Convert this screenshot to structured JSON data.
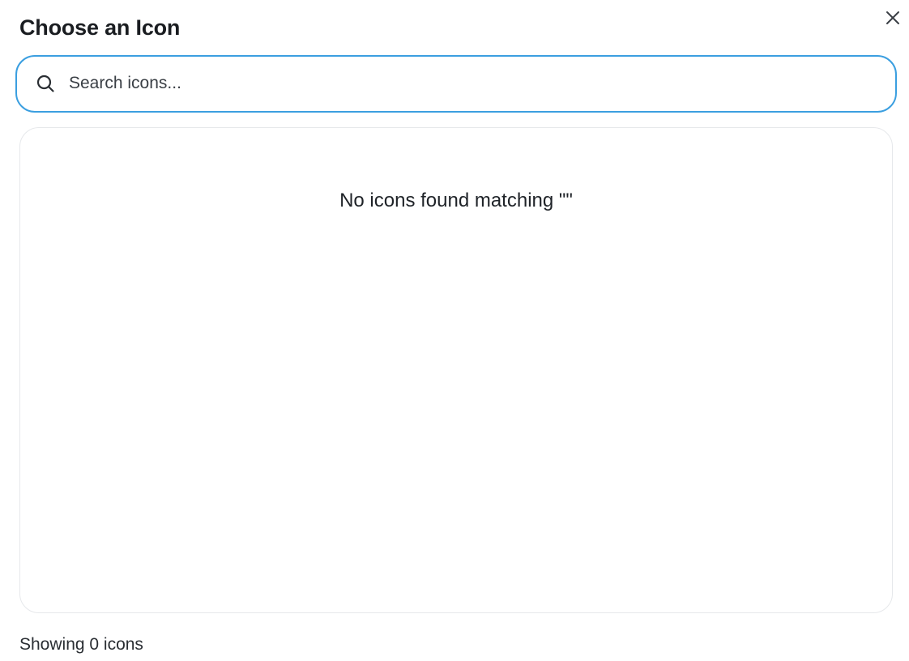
{
  "dialog": {
    "title": "Choose an Icon",
    "close_icon": "close-icon"
  },
  "search": {
    "icon": "search-icon",
    "placeholder": "Search icons...",
    "value": "",
    "focus_color": "#3b9fe0"
  },
  "results": {
    "empty_message": "No icons found matching \"\""
  },
  "footer": {
    "status": "Showing 0 icons"
  }
}
